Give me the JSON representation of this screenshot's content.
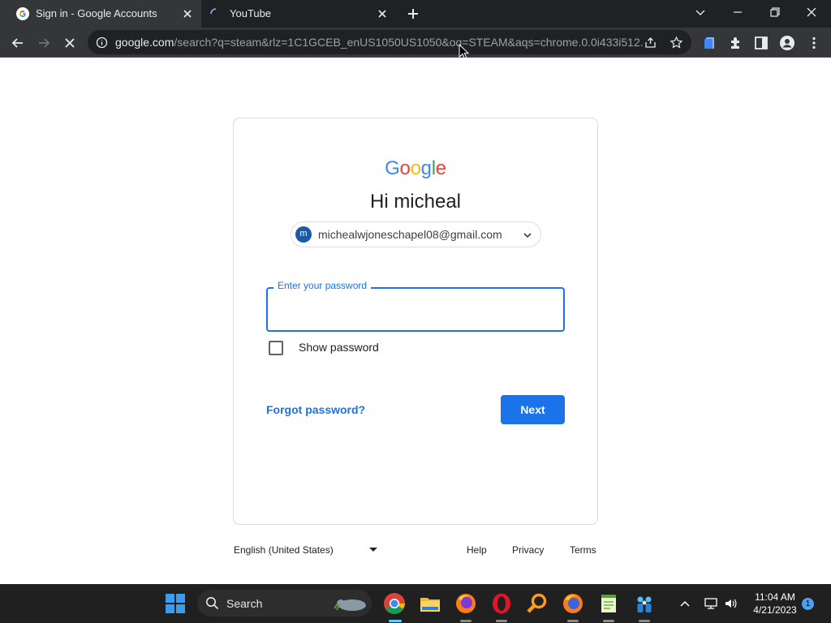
{
  "browser": {
    "tabs": [
      {
        "title": "Sign in - Google Accounts",
        "active": true
      },
      {
        "title": "YouTube",
        "active": false,
        "loading": true
      }
    ],
    "url_host": "google.com",
    "url_rest": "/search?q=steam&rlz=1C1GCEB_enUS1050US1050&oq=STEAM&aqs=chrome.0.0i433i512..."
  },
  "signin": {
    "logo_text": "Google",
    "heading": "Hi micheal",
    "email": "michealwjoneschapel08@gmail.com",
    "avatar_initial": "m",
    "password_label": "Enter your password",
    "password_value": "",
    "show_password_label": "Show password",
    "show_password_checked": false,
    "forgot_label": "Forgot password?",
    "next_label": "Next"
  },
  "footer": {
    "language": "English (United States)",
    "links": [
      "Help",
      "Privacy",
      "Terms"
    ]
  },
  "taskbar": {
    "search_label": "Search",
    "time": "11:04 AM",
    "date": "4/21/2023",
    "notification_count": "1"
  },
  "colors": {
    "accent": "#1a73e8",
    "google_blue": "#4285f4",
    "google_red": "#ea4335",
    "google_yellow": "#fbbc05",
    "google_green": "#34a853"
  }
}
